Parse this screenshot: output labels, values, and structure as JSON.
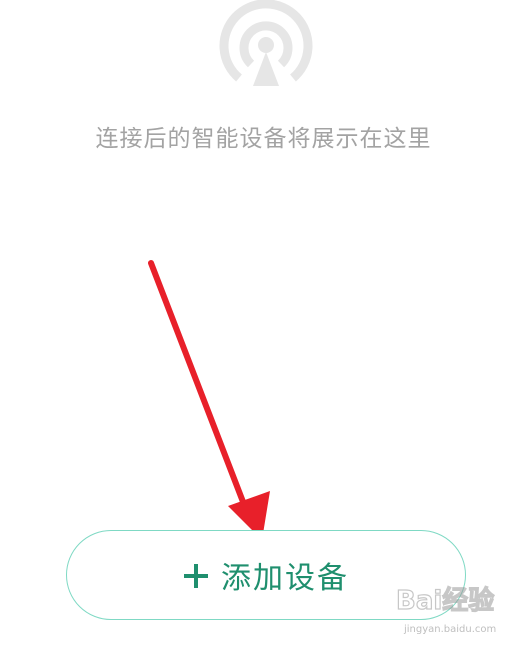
{
  "empty_state": {
    "icon": "signal-broadcast-icon",
    "message": "连接后的智能设备将展示在这里"
  },
  "add_device_button": {
    "icon": "plus-icon",
    "label": "添加设备"
  },
  "watermark": {
    "logo_text": "Bai经验",
    "sub_text": "jingyan.baidu.com"
  },
  "colors": {
    "accent": "#1f8f6e",
    "button_border": "#7fd9c4",
    "muted_text": "#a3a3a3",
    "icon_gray": "#e6e6e6",
    "annotation_arrow": "#e8202a"
  }
}
